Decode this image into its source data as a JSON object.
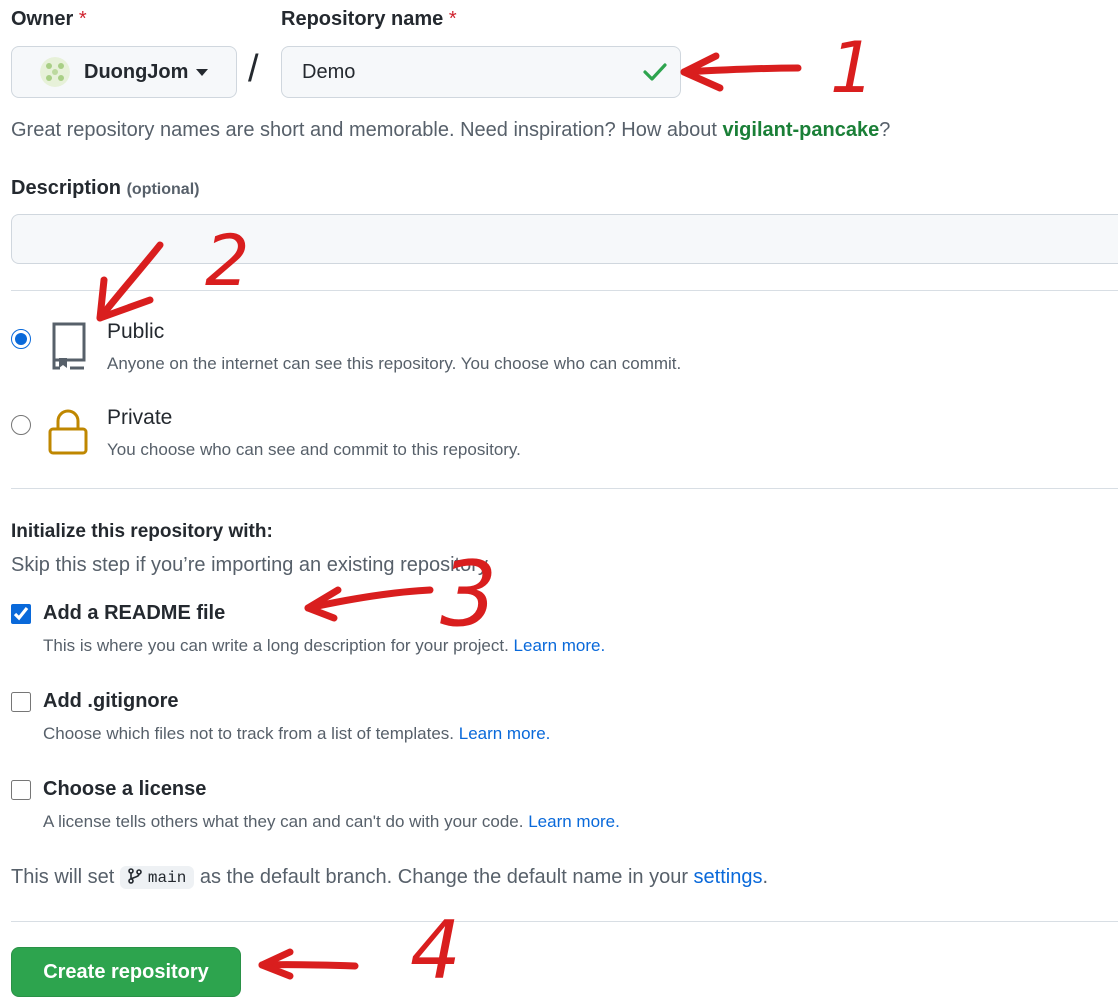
{
  "owner": {
    "label": "Owner",
    "required_mark": "*",
    "selected": "DuongJom"
  },
  "repo_name": {
    "label": "Repository name",
    "required_mark": "*",
    "value": "Demo"
  },
  "separator": "/",
  "name_hint": {
    "prefix": "Great repository names are short and memorable. Need inspiration? How about ",
    "suggestion": "vigilant-pancake",
    "suffix": "?"
  },
  "description": {
    "label": "Description",
    "optional": "(optional)",
    "value": ""
  },
  "visibility": {
    "public": {
      "title": "Public",
      "desc": "Anyone on the internet can see this repository. You choose who can commit.",
      "selected": true
    },
    "private": {
      "title": "Private",
      "desc": "You choose who can see and commit to this repository.",
      "selected": false
    }
  },
  "init": {
    "heading": "Initialize this repository with:",
    "subheading": "Skip this step if you’re importing an existing repository.",
    "readme": {
      "title": "Add a README file",
      "desc": "This is where you can write a long description for your project. ",
      "link": "Learn more.",
      "checked": true
    },
    "gitignore": {
      "title": "Add .gitignore",
      "desc": "Choose which files not to track from a list of templates. ",
      "link": "Learn more.",
      "checked": false
    },
    "license": {
      "title": "Choose a license",
      "desc": "A license tells others what they can and can't do with your code. ",
      "link": "Learn more.",
      "checked": false
    }
  },
  "branch": {
    "prefix": "This will set ",
    "name": "main",
    "middle": " as the default branch. Change the default name in your ",
    "link": "settings",
    "suffix": "."
  },
  "create_button": "Create repository",
  "annotations": {
    "n1": "1",
    "n2": "2",
    "n3": "3",
    "n4": "4"
  },
  "colors": {
    "accent_green": "#2da44e",
    "link_blue": "#0969da",
    "annotation_red": "#d91e1e",
    "lock_gold": "#bf8700"
  }
}
